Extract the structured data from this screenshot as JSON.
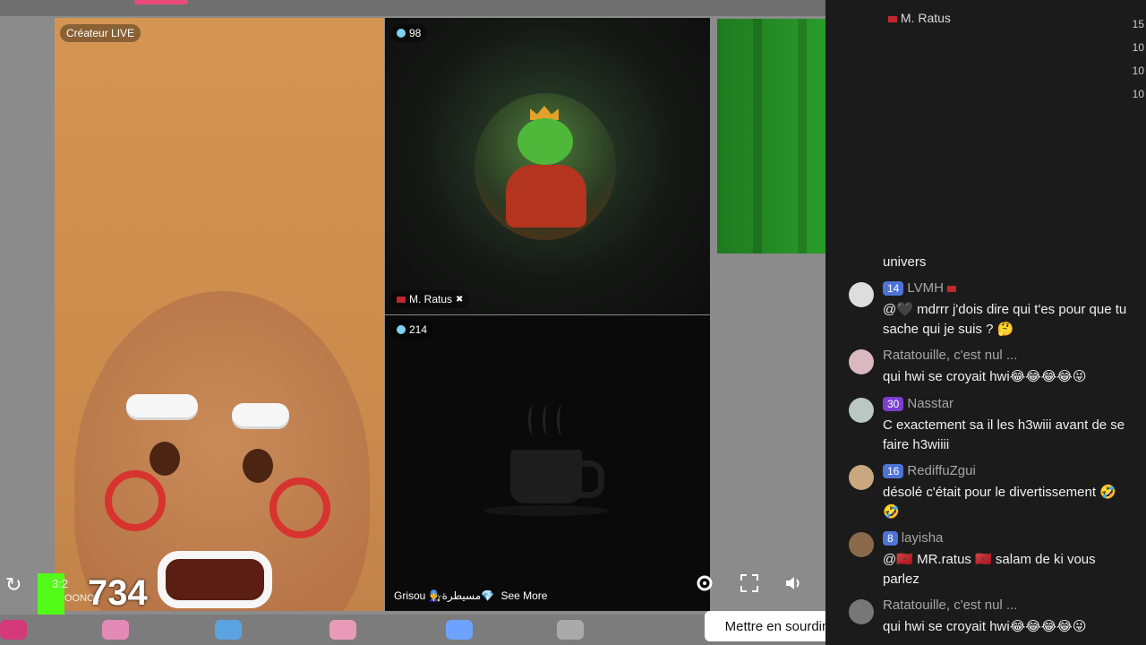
{
  "panels": {
    "creator": {
      "badge": "Créateur LIVE"
    },
    "ratus": {
      "viewers": "98",
      "name": "M. Ratus"
    },
    "grisou": {
      "viewers": "214",
      "name": "Grisou 👨‍🔧مسيطرة💎",
      "see_more": "See More"
    }
  },
  "overlay": {
    "time": "3:2",
    "sub": "OONO2",
    "count": "734"
  },
  "tooltip": "Mettre en sourdine (M)",
  "chat": {
    "top_user": "M. Ratus",
    "side_numbers": [
      "15",
      "10",
      "10",
      "10"
    ],
    "messages": [
      {
        "name": "",
        "level": "",
        "text": "univers"
      },
      {
        "name": "LVMH",
        "level": "14",
        "text": "@🖤 mdrrr j'dois dire qui t'es pour que tu sache qui je suis ? 🤔"
      },
      {
        "name": "Ratatouille, c'est nul ...",
        "level": "",
        "text": "qui hwi se croyait hwi😂😂😂😂😜"
      },
      {
        "name": "Nasstar",
        "level": "30",
        "text": "C exactement sa il les h3wiii avant de se faire h3wiiii"
      },
      {
        "name": "RediffuZgui",
        "level": "16",
        "text": "désolé c'était pour le divertissement 🤣🤣"
      },
      {
        "name": "layisha",
        "level": "8",
        "text": "@🇲🇦 MR.ratus 🇲🇦 salam de ki vous parlez"
      },
      {
        "name": "Ratatouille, c'est nul ...",
        "level": "",
        "text": "qui hwi se croyait hwi😂😂😂😂😜"
      }
    ]
  },
  "colors": {
    "kick_green": "#53fc18",
    "chat_bg": "#1b1b1b",
    "level_blue": "#4d73d6"
  }
}
